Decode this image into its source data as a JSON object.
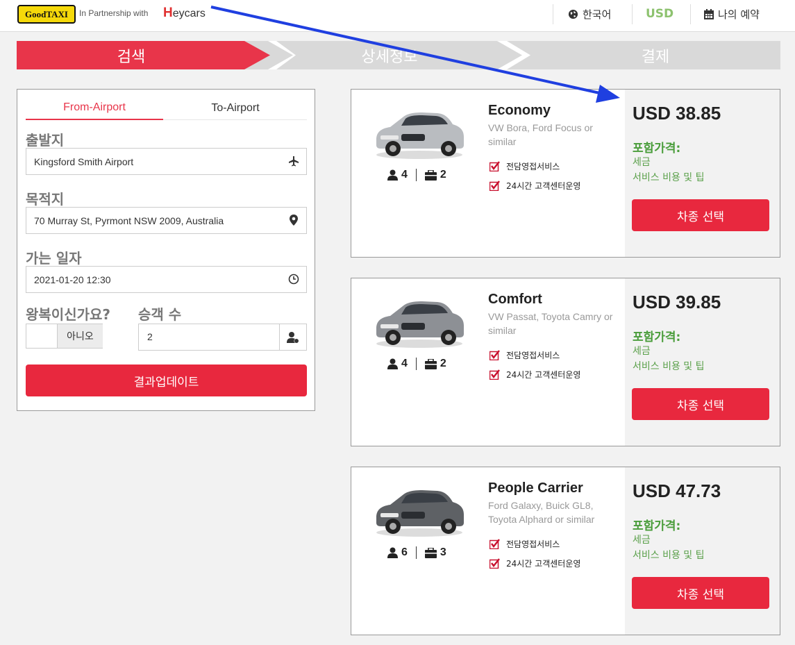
{
  "header": {
    "logo_text": "GoodTAXI",
    "partner_text": "In Partnership with",
    "partner_brand_first": "H",
    "partner_brand_rest": "eycars",
    "language": "한국어",
    "currency": "USD",
    "my_booking": "나의 예약"
  },
  "steps": [
    {
      "label": "검색",
      "active": true
    },
    {
      "label": "상세정보",
      "active": false
    },
    {
      "label": "결제",
      "active": false
    }
  ],
  "search": {
    "tabs": [
      {
        "label": "From-Airport",
        "active": true
      },
      {
        "label": "To-Airport",
        "active": false
      }
    ],
    "from_label": "출발지",
    "from_value": "Kingsford Smith Airport",
    "to_label": "목적지",
    "to_value": "70 Murray St, Pyrmont NSW 2009, Australia",
    "date_label": "가는 일자",
    "date_value": "2021-01-20 12:30",
    "return_label": "왕복이신가요?",
    "return_value": "아니오",
    "pax_label": "승객 수",
    "pax_value": "2",
    "update_button": "결과업데이트"
  },
  "vehicles": [
    {
      "name": "Economy",
      "desc": "VW Bora, Ford Focus or similar",
      "passengers": "4",
      "bags": "2",
      "features": [
        "전담영접서비스",
        "24시간 고객센터운영"
      ],
      "price": "USD 38.85",
      "included_label": "포함가격:",
      "included": [
        "세금",
        "서비스 비용 및 팁"
      ],
      "button": "차종 선택",
      "car_color": "#b9bcc0"
    },
    {
      "name": "Comfort",
      "desc": "VW Passat, Toyota Camry or similar",
      "passengers": "4",
      "bags": "2",
      "features": [
        "전담영접서비스",
        "24시간 고객센터운영"
      ],
      "price": "USD 39.85",
      "included_label": "포함가격:",
      "included": [
        "세금",
        "서비스 비용 및 팁"
      ],
      "button": "차종 선택",
      "car_color": "#8d9095"
    },
    {
      "name": "People Carrier",
      "desc": "Ford Galaxy, Buick GL8, Toyota Alphard or similar",
      "passengers": "6",
      "bags": "3",
      "features": [
        "전담영접서비스",
        "24시간 고객센터운영"
      ],
      "price": "USD 47.73",
      "included_label": "포함가격:",
      "included": [
        "세금",
        "서비스 비용 및 팁"
      ],
      "button": "차종 선택",
      "car_color": "#5e6165"
    }
  ],
  "colors": {
    "accent": "#e8283e",
    "green": "#4a9d3b",
    "arrow": "#1f3fe0"
  }
}
